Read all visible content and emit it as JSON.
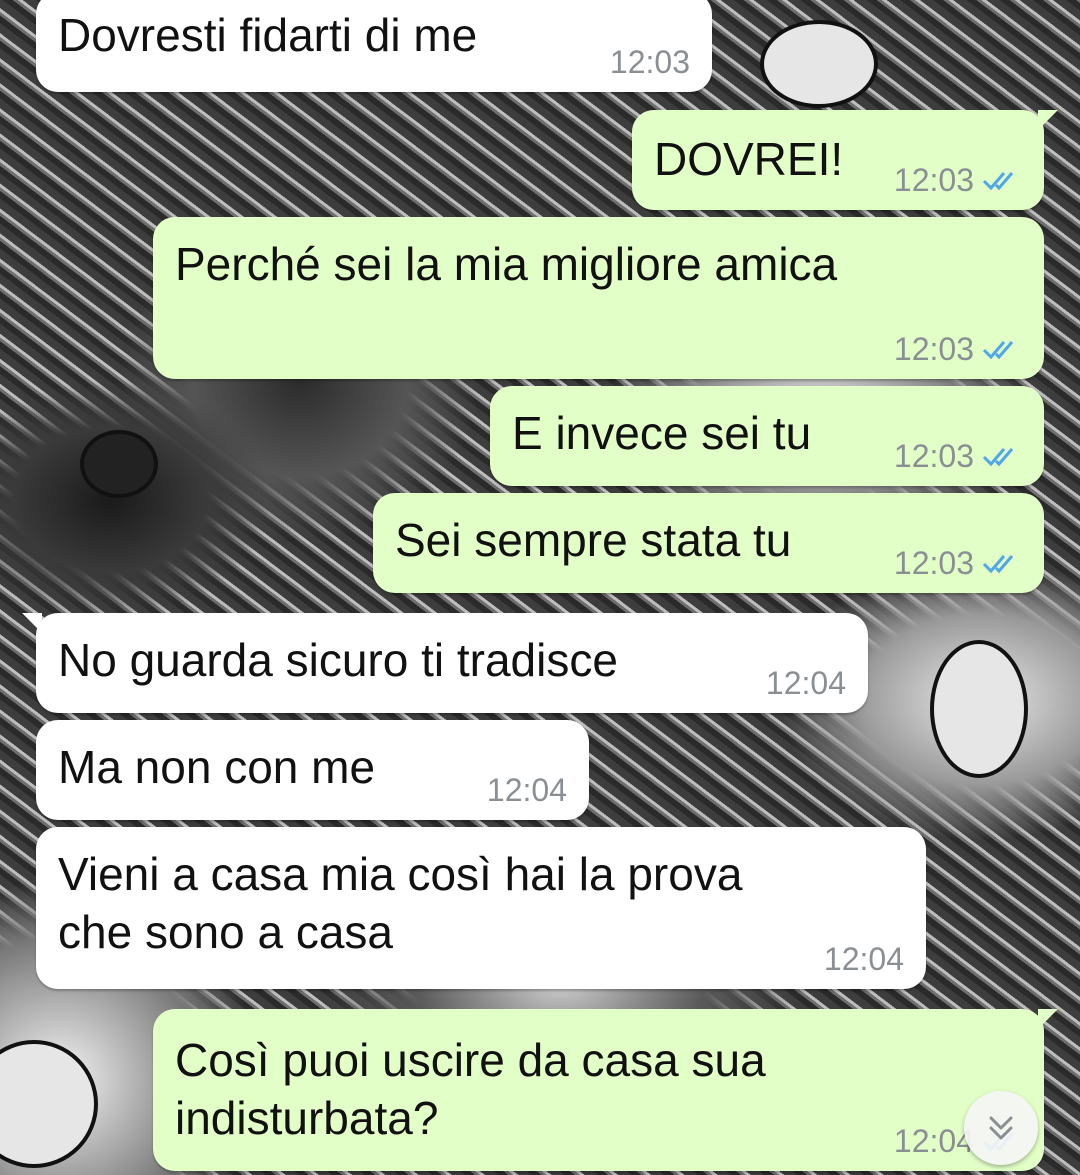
{
  "chat": {
    "messages": [
      {
        "direction": "incoming",
        "text": "Dovresti fidarti di me",
        "time": "12:03"
      },
      {
        "direction": "outgoing",
        "text": "DOVREI!",
        "time": "12:03",
        "status": "read"
      },
      {
        "direction": "outgoing",
        "text": "Perché sei la mia migliore amica",
        "time": "12:03",
        "status": "read"
      },
      {
        "direction": "outgoing",
        "text": "E invece sei tu",
        "time": "12:03",
        "status": "read"
      },
      {
        "direction": "outgoing",
        "text": "Sei sempre stata tu",
        "time": "12:03",
        "status": "read"
      },
      {
        "direction": "incoming",
        "text": "No guarda sicuro ti tradisce",
        "time": "12:04"
      },
      {
        "direction": "incoming",
        "text": "Ma non con me",
        "time": "12:04"
      },
      {
        "direction": "incoming",
        "text": "Vieni a casa mia così hai la prova\nche sono a casa",
        "time": "12:04"
      },
      {
        "direction": "outgoing",
        "text": "Così puoi uscire da casa sua\nindisturbata?",
        "time": "12:04",
        "status": "read"
      }
    ]
  },
  "colors": {
    "incoming_bubble": "#ffffff",
    "outgoing_bubble": "#e2ffc7",
    "timestamp": "#8a8f94",
    "read_ticks": "#4fa6e8"
  },
  "icons": {
    "read_receipt": "double-check-icon",
    "scroll_down": "chevron-double-down-icon"
  }
}
